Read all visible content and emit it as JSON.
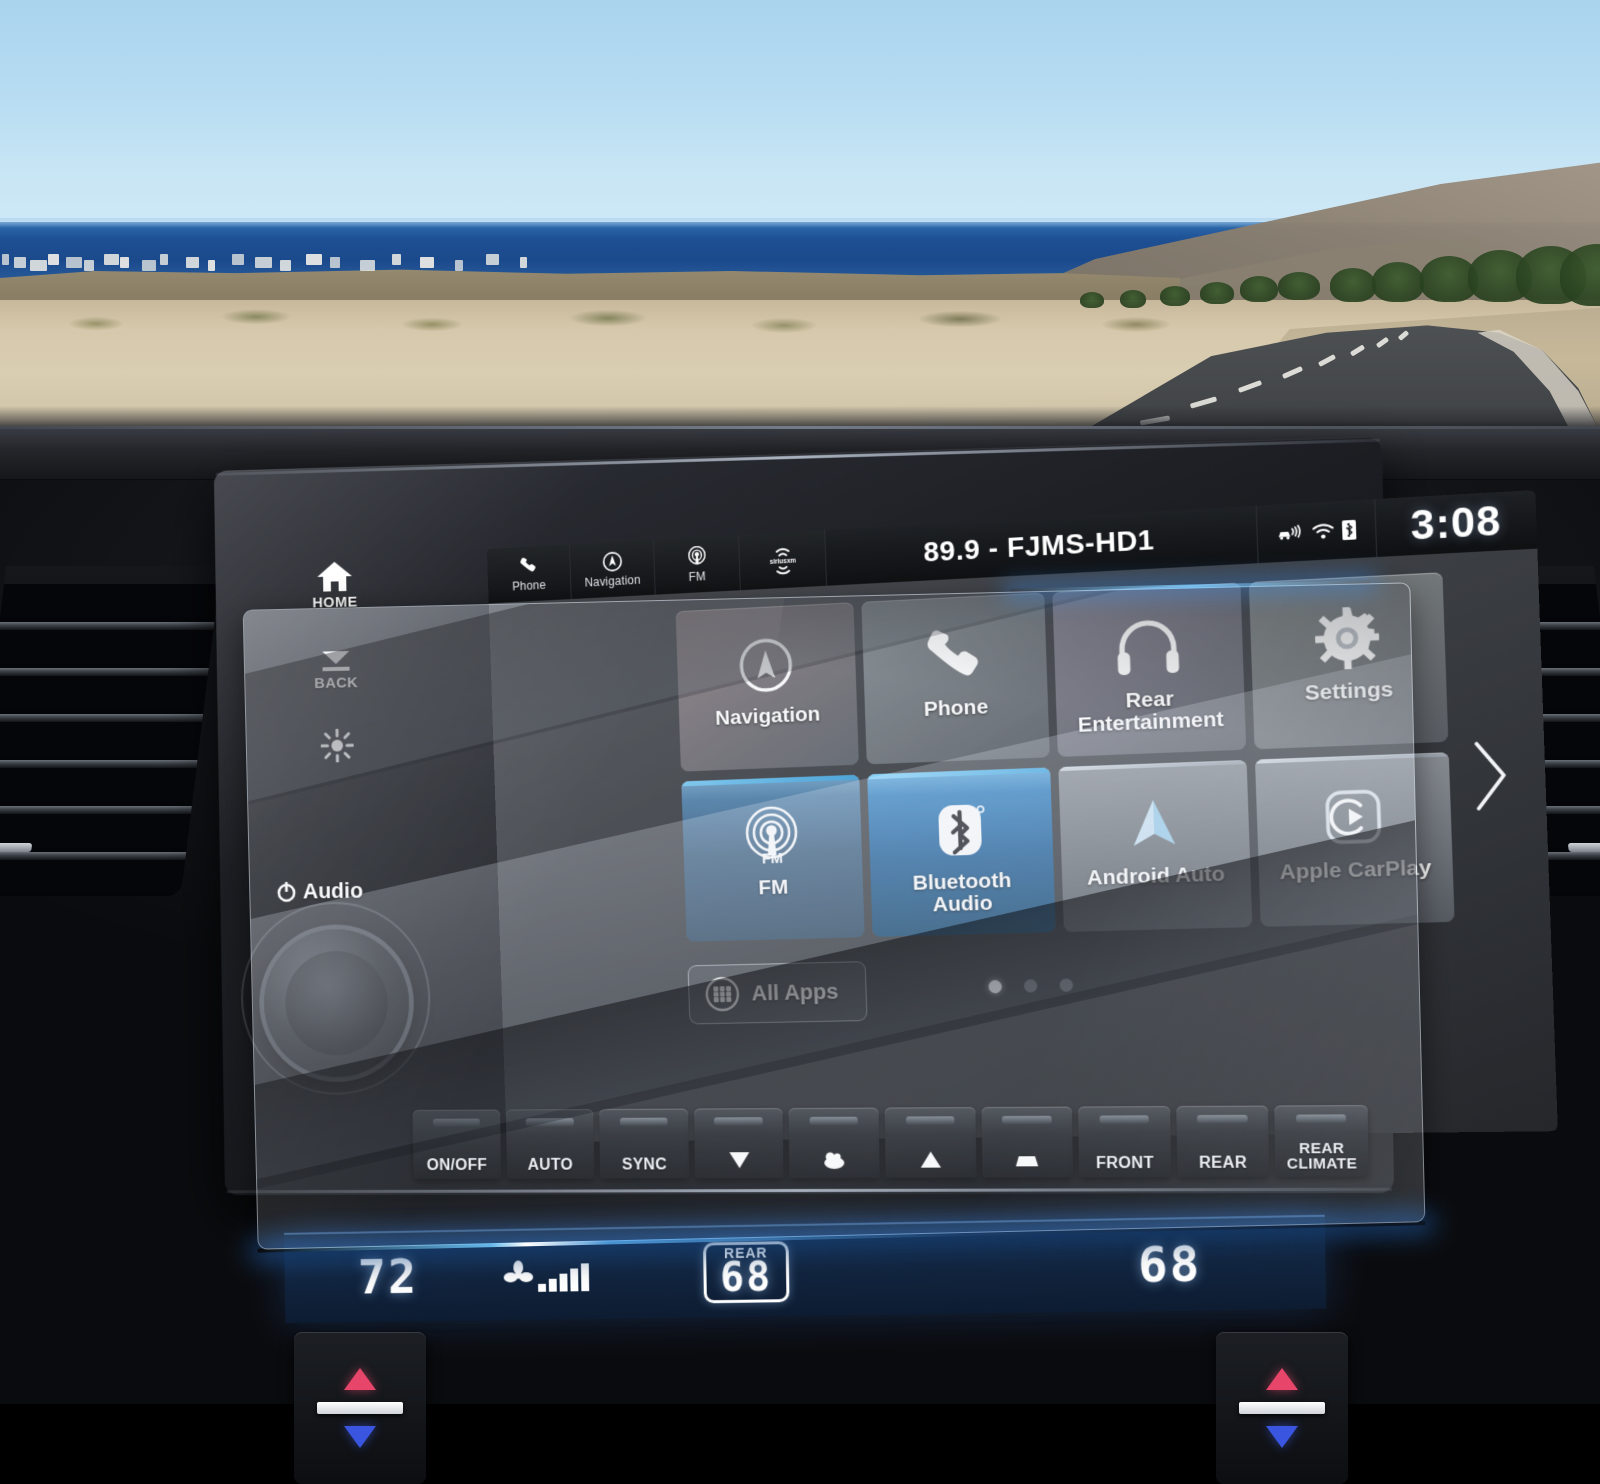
{
  "scene": {
    "description": "Car infotainment touchscreen with tempered glass screen protector overlay",
    "windshield_view": "Coastal desert road with ocean horizon"
  },
  "statusbar": {
    "buttons": [
      {
        "label": "Phone",
        "icon": "phone-handset-icon"
      },
      {
        "label": "Navigation",
        "icon": "compass-icon"
      },
      {
        "label": "FM",
        "icon": "radio-tower-icon"
      },
      {
        "label": "SiriusXM",
        "icon": "siriusxm-icon"
      }
    ],
    "station": "89.9 - FJMS-HD1",
    "indicators": [
      {
        "name": "telematics-icon"
      },
      {
        "name": "wifi-icon"
      },
      {
        "name": "bluetooth-sim-icon"
      }
    ],
    "clock": "3:08"
  },
  "home": {
    "tiles_row1": [
      {
        "label": "Navigation",
        "icon": "compass-icon"
      },
      {
        "label": "Phone",
        "icon": "phone-handset-icon"
      },
      {
        "label": "Rear\nEntertainment",
        "label_line1": "Rear",
        "label_line2": "Entertainment",
        "icon": "headphones-icon"
      },
      {
        "label": "Settings",
        "icon": "gear-icon"
      }
    ],
    "tiles_row2": [
      {
        "label": "FM",
        "icon": "fm-radio-icon"
      },
      {
        "label_line1": "Bluetooth",
        "label_line2": "Audio",
        "icon": "bluetooth-icon"
      },
      {
        "label": "Android Auto",
        "icon": "android-auto-icon"
      },
      {
        "label": "Apple CarPlay",
        "icon": "apple-carplay-icon"
      }
    ],
    "all_apps_label": "All Apps",
    "all_apps_icon": "grid-apps-icon",
    "pages": 3,
    "active_page": 1,
    "next_page_icon": "chevron-right-icon"
  },
  "sidekeys": [
    {
      "label": "HOME",
      "icon": "house-icon"
    },
    {
      "label": "BACK",
      "icon": "back-arrow-icon"
    },
    {
      "label": "",
      "icon": "brightness-icon"
    },
    {
      "label": "Audio",
      "icon": "power-icon"
    }
  ],
  "climate_buttons": [
    {
      "label": "ON/OFF",
      "icon": "fan-on-icon"
    },
    {
      "label": "AUTO",
      "icon": ""
    },
    {
      "label": "SYNC",
      "icon": ""
    },
    {
      "label": "",
      "icon": "airflow-down-icon"
    },
    {
      "label": "",
      "icon": "airflow-face-icon"
    },
    {
      "label": "",
      "icon": "airflow-up-icon"
    },
    {
      "label": "",
      "icon": "airflow-windshield-icon"
    },
    {
      "label": "FRONT",
      "icon": "defrost-front-icon"
    },
    {
      "label": "REAR",
      "icon": "defrost-rear-icon"
    },
    {
      "label_line1": "REAR",
      "label_line2": "CLIMATE",
      "icon": ""
    }
  ],
  "climate_display": {
    "driver_temp": "72",
    "fan_icon": "fan-speed-icon",
    "fan_level": 5,
    "fan_max": 7,
    "rear_label": "REAR",
    "rear_temp": "68",
    "passenger_temp": "68"
  },
  "temp_rockers": {
    "left": {
      "up_icon": "temp-up-triangle-icon",
      "down_icon": "temp-down-triangle-icon"
    },
    "right": {
      "up_icon": "temp-up-triangle-icon",
      "down_icon": "temp-down-triangle-icon"
    }
  },
  "colors": {
    "accent_blue": "#3C9CFF",
    "tile_blue": "#2E7FC0",
    "temp_up_red": "#E8456B",
    "temp_down_blue": "#3A56E0",
    "screen_bg": "#3C3F44"
  }
}
